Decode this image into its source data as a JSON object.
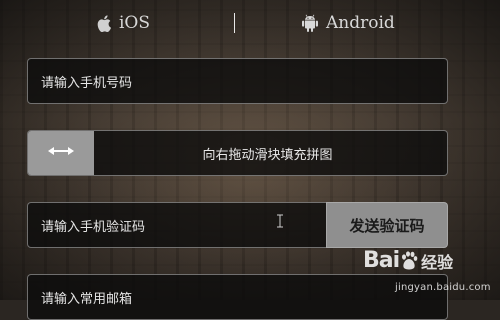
{
  "platforms": {
    "ios": {
      "label": "iOS",
      "icon": "apple-icon"
    },
    "android": {
      "label": "Android",
      "icon": "android-icon"
    }
  },
  "form": {
    "phone_placeholder": "请输入手机号码",
    "slider": {
      "handle_icon": "double-arrow-icon",
      "text": "向右拖动滑块填充拼图"
    },
    "sms_code_placeholder": "请输入手机验证码",
    "send_code_label": "发送验证码",
    "email_placeholder": "请输入常用邮箱"
  },
  "watermark": {
    "brand_left": "Bai",
    "brand_right": "经验",
    "url": "jingyan.baidu.com"
  },
  "colors": {
    "field_bg": "#0c0c0c",
    "slider_handle": "#9a9a9a",
    "send_button": "#8f8f8f"
  }
}
